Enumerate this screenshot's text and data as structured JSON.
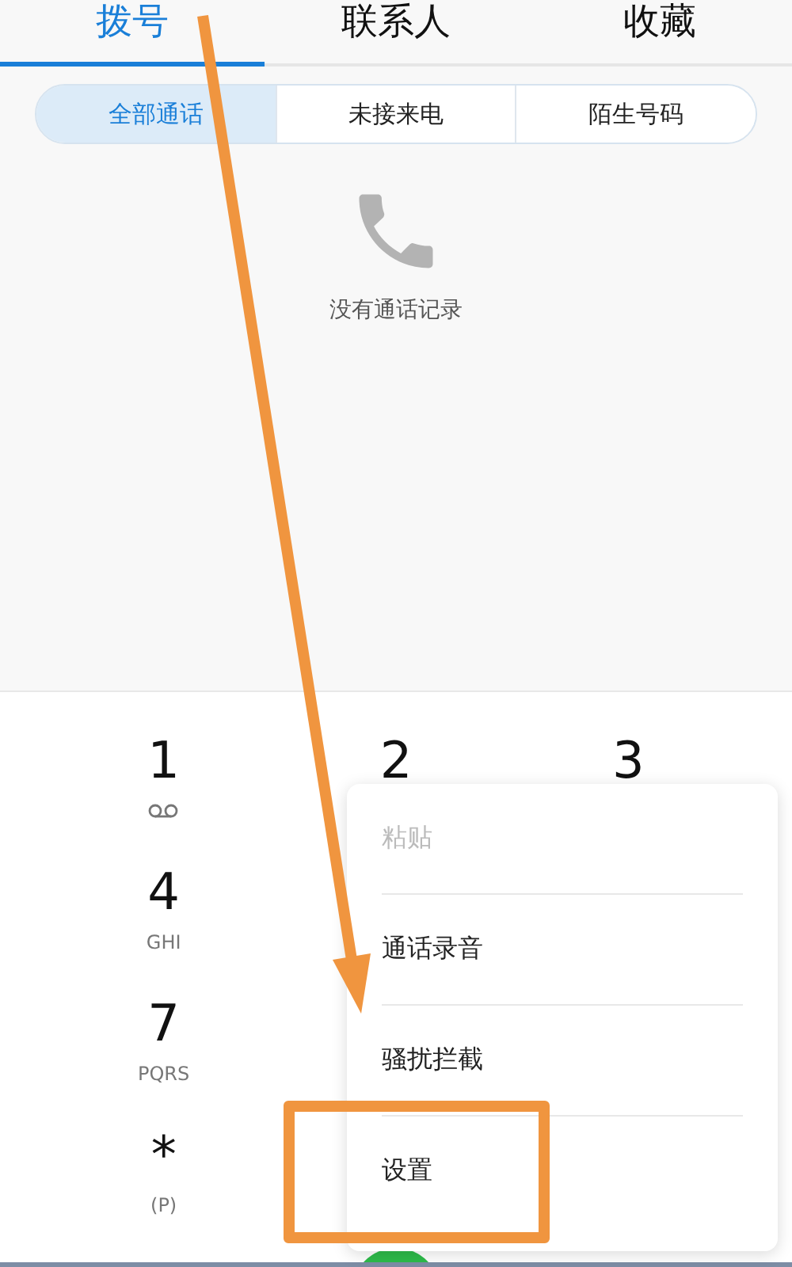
{
  "tabs": [
    {
      "label": "拨号",
      "selected": true
    },
    {
      "label": "联系人",
      "selected": false
    },
    {
      "label": "收藏",
      "selected": false
    }
  ],
  "filters": [
    {
      "label": "全部通话",
      "selected": true
    },
    {
      "label": "未接来电",
      "selected": false
    },
    {
      "label": "陌生号码",
      "selected": false
    }
  ],
  "empty_state": {
    "message": "没有通话记录"
  },
  "keypad": [
    {
      "digit": "1",
      "kind": "voicemail"
    },
    {
      "digit": "2",
      "kind": "plain"
    },
    {
      "digit": "3",
      "kind": "plain"
    },
    {
      "digit": "4",
      "kind": "letters",
      "letters": "GHI"
    },
    {
      "digit": "7",
      "kind": "letters",
      "letters": "PQRS"
    },
    {
      "digit": "*",
      "kind": "letters",
      "letters": "(P)"
    }
  ],
  "menu": [
    {
      "label": "粘贴",
      "disabled": true
    },
    {
      "label": "通话录音",
      "disabled": false
    },
    {
      "label": "骚扰拦截",
      "disabled": false
    },
    {
      "label": "设置",
      "disabled": false,
      "highlighted": true
    }
  ]
}
